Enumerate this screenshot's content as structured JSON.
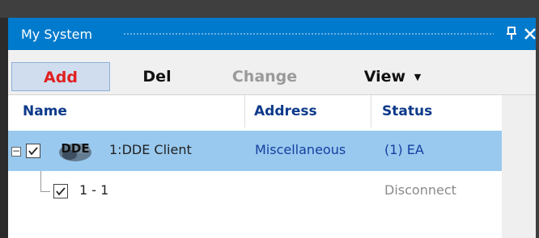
{
  "panel": {
    "title": "My System"
  },
  "toolbar": {
    "add_label": "Add",
    "del_label": "Del",
    "change_label": "Change",
    "view_label": "View"
  },
  "grid": {
    "columns": [
      "Name",
      "Address",
      "Status"
    ],
    "rows": [
      {
        "icon_text": "DDE",
        "name": "1:DDE Client",
        "address": "Miscellaneous",
        "status": "(1) EA",
        "checked": true,
        "expanded": true,
        "selected": true
      },
      {
        "name": "1 - 1",
        "address": "",
        "status": "Disconnect",
        "checked": true
      }
    ]
  },
  "colors": {
    "titlebar": "#007acc",
    "selected_row": "#99c9ef",
    "header_text": "#0d3a8a",
    "add_text": "#e02020"
  }
}
